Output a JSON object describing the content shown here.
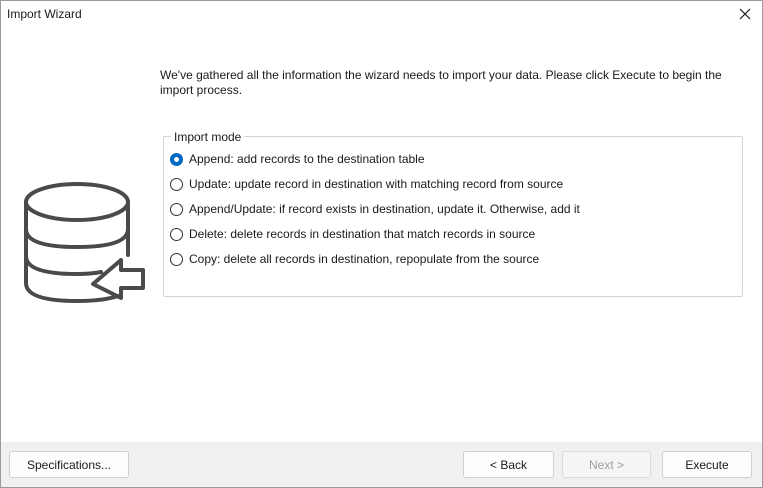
{
  "window": {
    "title": "Import Wizard"
  },
  "main": {
    "intro": "We've gathered all the information the wizard needs to import your data. Please click Execute to begin the import process.",
    "import_mode": {
      "legend": "Import mode",
      "options": [
        {
          "label": "Append: add records to the destination table",
          "checked": true
        },
        {
          "label": "Update: update record in destination with matching record from source",
          "checked": false
        },
        {
          "label": "Append/Update: if record exists in destination, update it. Otherwise, add it",
          "checked": false
        },
        {
          "label": "Delete: delete records in destination that match records in source",
          "checked": false
        },
        {
          "label": "Copy: delete all records in destination, repopulate from the source",
          "checked": false
        }
      ]
    }
  },
  "footer": {
    "specifications_label": "Specifications...",
    "back_label": "< Back",
    "next_label": "Next >",
    "execute_label": "Execute"
  },
  "icons": {
    "close": "close-icon",
    "database_import": "database-import-icon"
  },
  "colors": {
    "accent": "#0067c0",
    "icon_stroke": "#4a4a4a"
  }
}
